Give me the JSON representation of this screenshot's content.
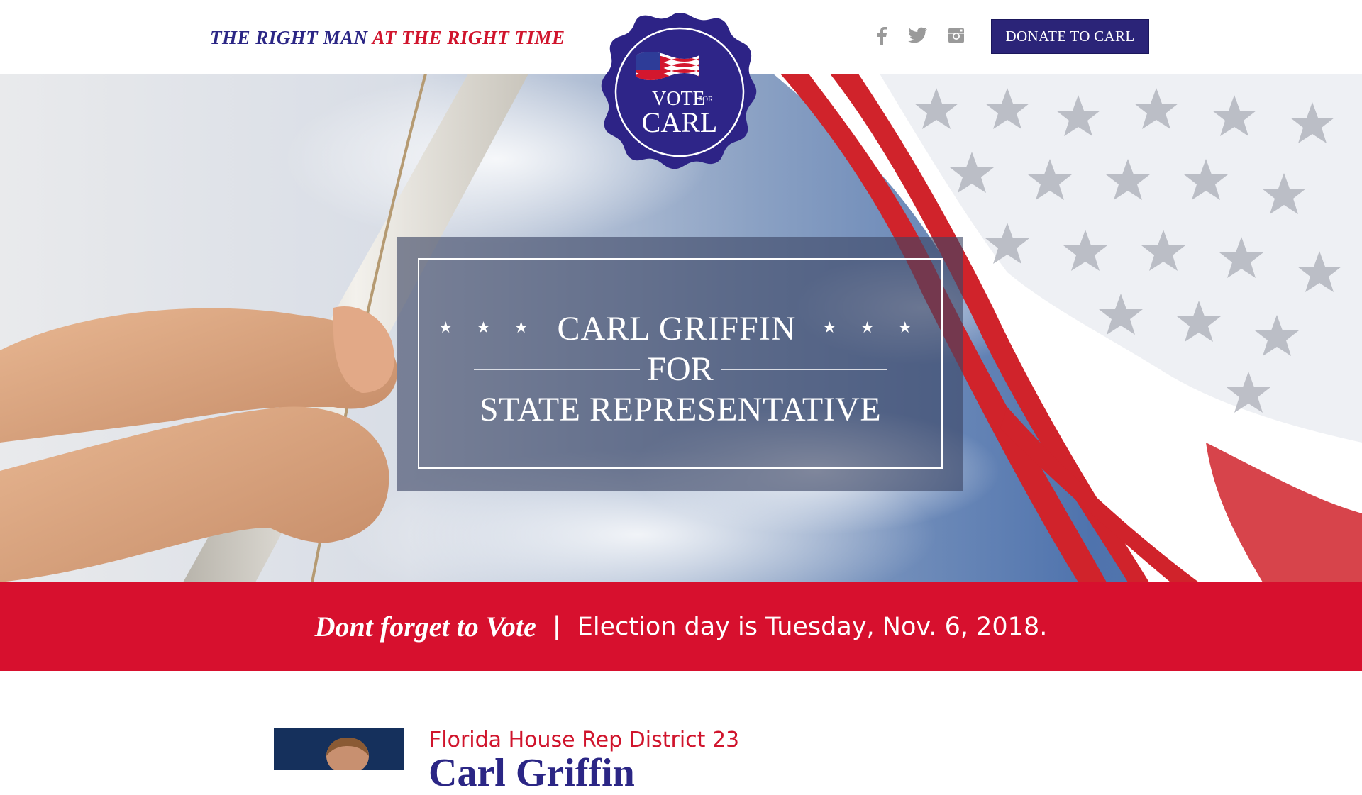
{
  "header": {
    "tagline_part1": "THE RIGHT MAN",
    "tagline_part2": "AT THE RIGHT TIME",
    "donate_label": "DONATE TO CARL",
    "social": [
      "facebook-icon",
      "twitter-icon",
      "instagram-icon"
    ]
  },
  "badge": {
    "vote": "VOTE",
    "for": "FOR",
    "name": "CARL"
  },
  "hero": {
    "stars": "★ ★ ★",
    "line1": "CARL GRIFFIN",
    "line2": "FOR",
    "line3": "STATE REPRESENTATIVE"
  },
  "banner": {
    "italic": "Dont forget to Vote",
    "separator": "|",
    "text": "Election day is Tuesday, Nov. 6, 2018."
  },
  "bio": {
    "district": "Florida House Rep District 23",
    "name": "Carl Griffin"
  },
  "colors": {
    "navy": "#2b2478",
    "red": "#d7102e",
    "white": "#ffffff"
  }
}
